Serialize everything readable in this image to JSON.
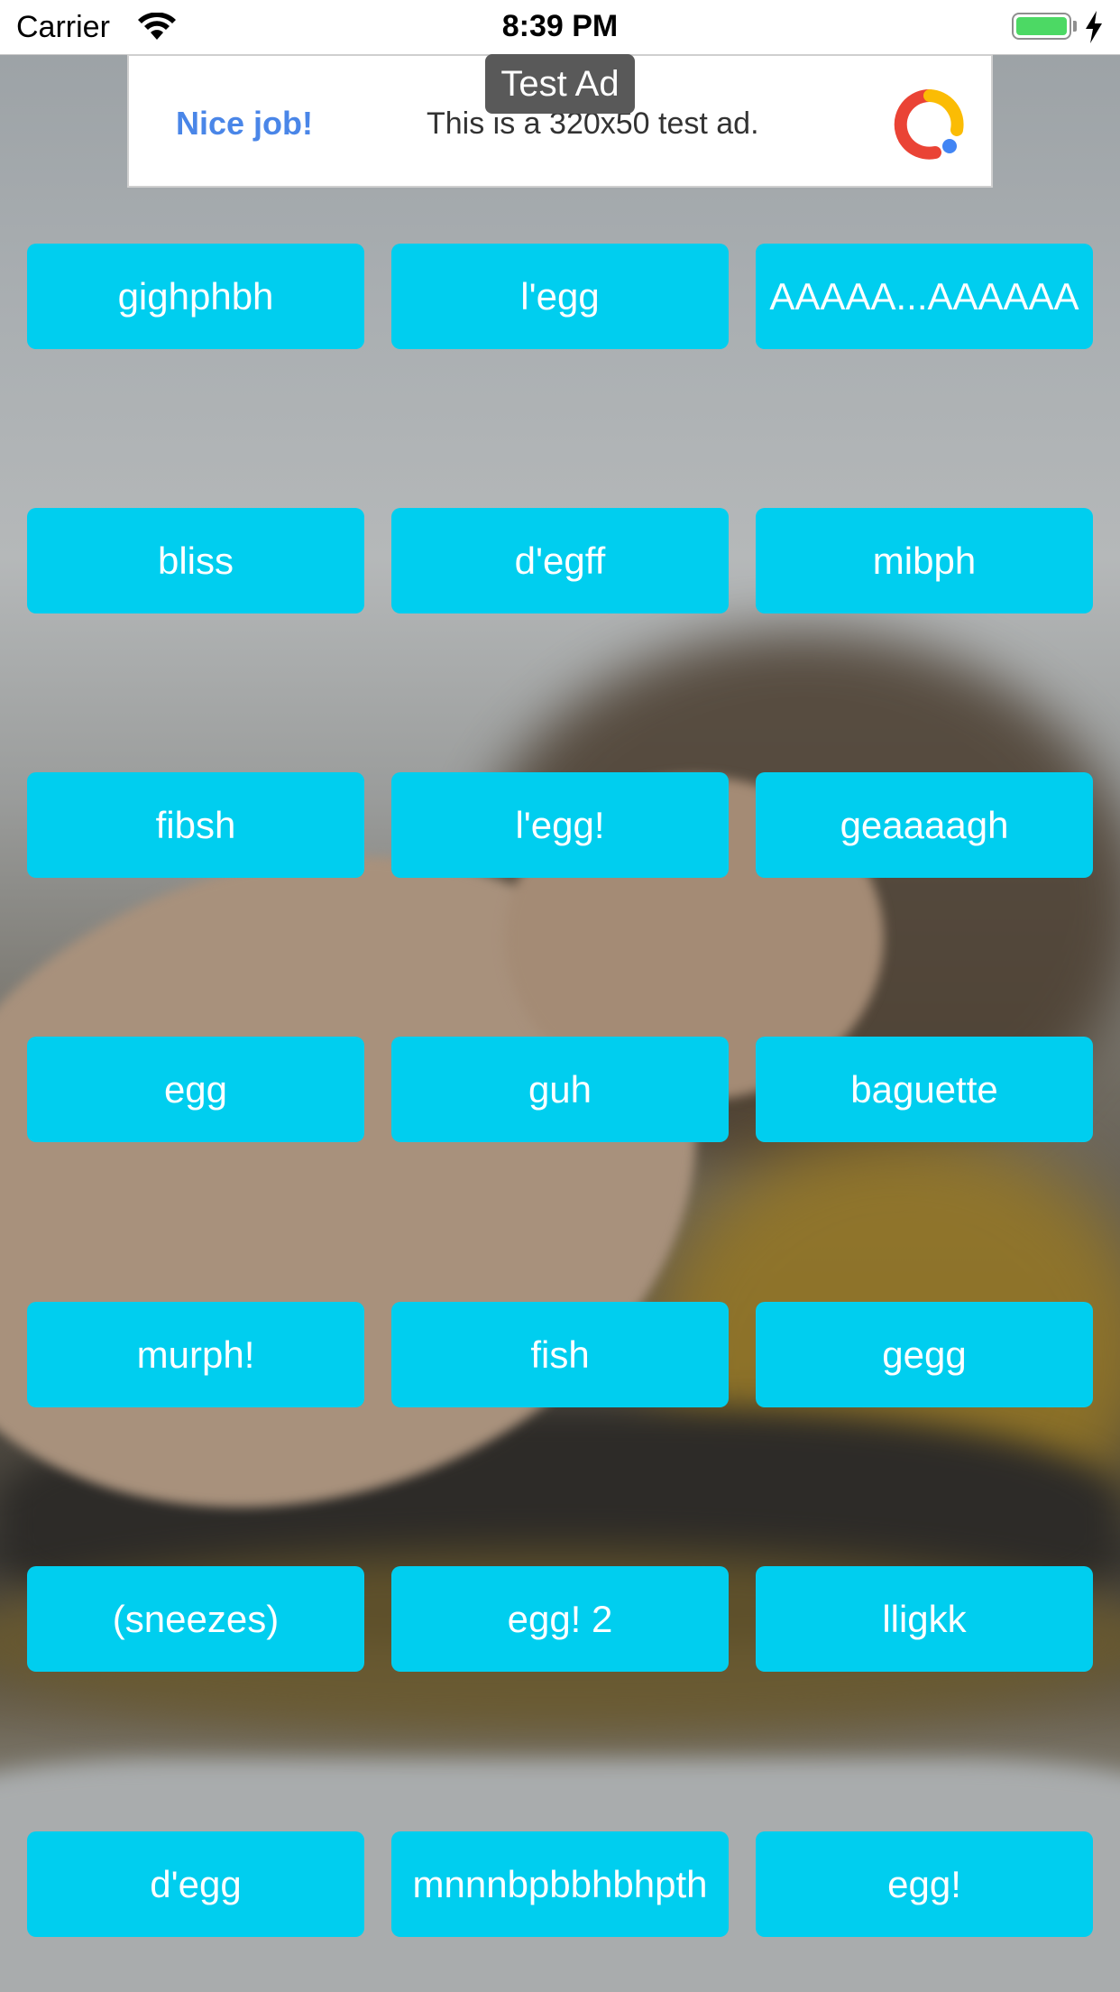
{
  "status_bar": {
    "carrier": "Carrier",
    "time": "8:39 PM",
    "battery_color": "#4cd964"
  },
  "ad": {
    "cta": "Nice job!",
    "text": "This is a 320x50 test ad.",
    "label": "Test Ad",
    "logo_icon": "google-ads-logo-icon"
  },
  "buttons": {
    "color": "#00ceef",
    "labels": [
      "gighphbh",
      "l'egg",
      "AAAAA...AAAAAA",
      "bliss",
      "d'egff",
      "mibph",
      "fibsh",
      "l'egg!",
      "geaaaagh",
      "egg",
      "guh",
      "baguette",
      "murph!",
      "fish",
      "gegg",
      "(sneezes)",
      "egg! 2",
      "lligkk",
      "d'egg",
      "mnnnbpbbhbhpth",
      "egg!"
    ]
  }
}
